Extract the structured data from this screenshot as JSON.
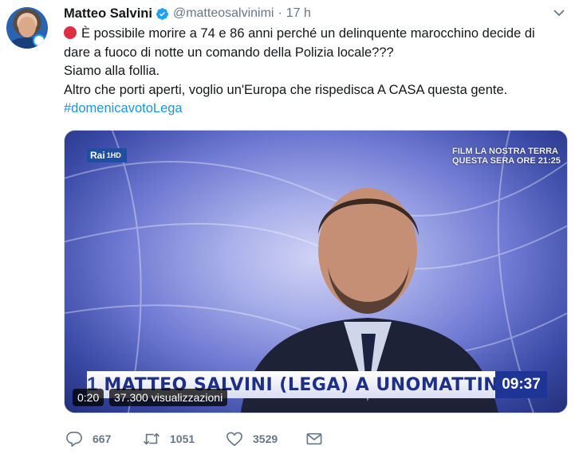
{
  "tweet": {
    "author_name": "Matteo Salvini",
    "handle": "@matteosalvinimi",
    "separator": "·",
    "time": "17 h",
    "lines": [
      "È possibile morire a 74 e 86 anni perché un delinquente marocchino decide di",
      "dare a fuoco di notte un comando della Polizia locale???",
      "Siamo alla follia.",
      "Altro che porti aperti, voglio un'Europa che rispedisca A CASA questa gente."
    ],
    "hashtag": "#domenicavotoLega"
  },
  "video": {
    "channel_logo": "Rai",
    "channel_sub": "1HD",
    "promo_line1": "FILM LA NOSTRA TERRA",
    "promo_line2": "QUESTA SERA ORE 21:25",
    "lower_third_number": "1",
    "lower_third_text": "MATTEO SALVINI (LEGA) A UNOMATTINA",
    "clock": "09:37",
    "elapsed": "0:20",
    "views": "37.300 visualizzazioni"
  },
  "actions": {
    "replies": "667",
    "retweets": "1051",
    "likes": "3529"
  },
  "icons": {
    "verified": "verified-badge-icon",
    "caret": "chevron-down-icon",
    "reply": "reply-icon",
    "retweet": "retweet-icon",
    "like": "heart-icon",
    "dm": "envelope-icon",
    "emoji": "red-circle-emoji"
  },
  "colors": {
    "link": "#1b95e0",
    "secondary": "#657786",
    "verified": "#1da1f2",
    "emoji_red": "#dd2e44"
  }
}
